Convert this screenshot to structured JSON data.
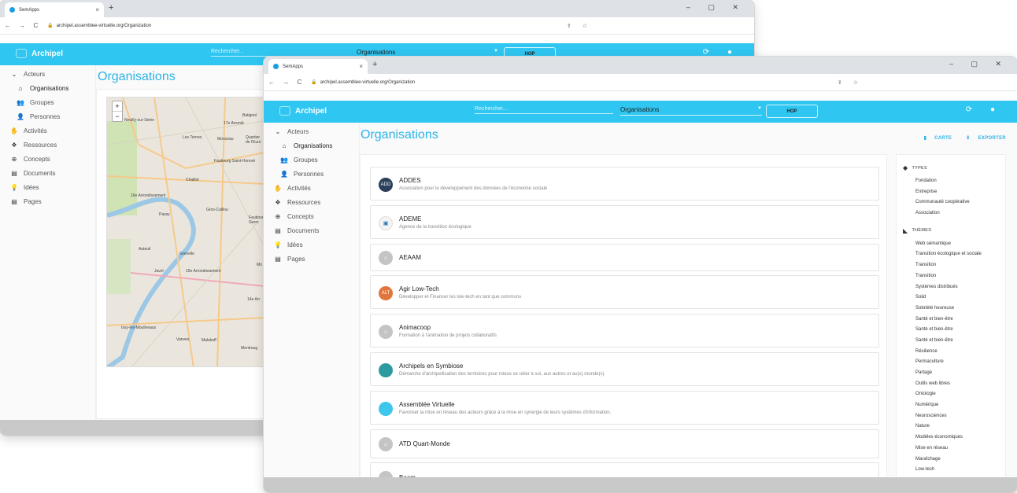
{
  "browser": {
    "tab_title": "SemApps",
    "tab_close": "×",
    "new_tab": "+",
    "window_controls": "–  ▢  ✕",
    "nav": "← → C",
    "lock": "🔒",
    "url": "archipel.assemblee-virtuelle.org/Organization",
    "tools": "⇪ ☆"
  },
  "app": {
    "brand": "Archipel",
    "search_placeholder": "Rechercher...",
    "select_value": "Organisations",
    "caret": "▼",
    "hop_label": "HOP",
    "icons": "⟳ ●"
  },
  "sidebar": {
    "items": [
      {
        "icon": "⌄",
        "label": "Acteurs"
      },
      {
        "icon": "⌂",
        "label": "Organisations"
      },
      {
        "icon": "👥",
        "label": "Groupes"
      },
      {
        "icon": "👤",
        "label": "Personnes"
      },
      {
        "icon": "✋",
        "label": "Activités"
      },
      {
        "icon": "❖",
        "label": "Ressources"
      },
      {
        "icon": "⊕",
        "label": "Concepts"
      },
      {
        "icon": "▤",
        "label": "Documents"
      },
      {
        "icon": "💡",
        "label": "Idées"
      },
      {
        "icon": "▤",
        "label": "Pages"
      }
    ]
  },
  "page": {
    "title": "Organisations",
    "action_map": "CARTE",
    "action_export": "EXPORTER"
  },
  "map": {
    "zoom_in": "+",
    "zoom_out": "−",
    "labels": [
      "Neuilly-sur-Seine",
      "Batignol",
      "17e Arrondi",
      "Les Ternes",
      "Monceau",
      "Quartier de l'Euro",
      "Faubourg Saint-Honoré",
      "Chaillot",
      "16e Arrondissement",
      "Gros-Caillou",
      "Passy",
      "Faubourg Germ",
      "Auteuil",
      "Grenelle",
      "Javel",
      "15e Arrondissement",
      "14e Arr",
      "Issy-les-Moulineaux",
      "Vanves",
      "Malakoff",
      "Montroug",
      "Mo"
    ]
  },
  "organisations": [
    {
      "name": "ADDES",
      "description": "Association pour le développement des données de l'économie sociale",
      "avatar": "ADD",
      "color": "#2a3f5a"
    },
    {
      "name": "ADEME",
      "description": "Agence de la transition écologique",
      "avatar": "▣",
      "color": "#f4f4f4"
    },
    {
      "name": "AEAAM",
      "description": "",
      "avatar": "⌂",
      "color": "#c4c4c4"
    },
    {
      "name": "Agir Low-Tech",
      "description": "Développer et Financer les low-tech en tant que communs",
      "avatar": "ALT",
      "color": "#e0763d"
    },
    {
      "name": "Animacoop",
      "description": "Formation à l'animation de projets collaboratifs",
      "avatar": "⌂",
      "color": "#c4c4c4"
    },
    {
      "name": "Archipels en Symbiose",
      "description": "Démarche d'archipellisation des territoires pour mieux se relier à soi, aux autres et au(x) monde(s)",
      "avatar": "",
      "color": "#2d9aa0"
    },
    {
      "name": "Assemblée Virtuelle",
      "description": "Favoriser la mise en réseau des acteurs grâce à la mise en synergie de leurs systèmes d'information.",
      "avatar": "",
      "color": "#3ec6ec"
    },
    {
      "name": "ATD Quart-Monde",
      "description": "",
      "avatar": "⌂",
      "color": "#c4c4c4"
    },
    {
      "name": "Baam",
      "description": "",
      "avatar": "⌂",
      "color": "#c4c4c4"
    }
  ],
  "filters": {
    "types_label": "TYPES",
    "types": [
      "Fondation",
      "Entreprise",
      "Communauté coopérative",
      "Association"
    ],
    "themes_label": "THÈMES",
    "themes": [
      "Web sémantique",
      "Transition écologique et sociale",
      "Transition",
      "Transition",
      "Systèmes distribués",
      "Solid",
      "Sobriété heureuse",
      "Santé et bien-être",
      "Santé et bien-être",
      "Santé et bien-être",
      "Résilience",
      "Permaculture",
      "Partage",
      "Outils web libres",
      "Ontologie",
      "Numérique",
      "Neurosciences",
      "Nature",
      "Modèles économiques",
      "Mise en réseau",
      "Maraîchage",
      "Low-tech"
    ]
  }
}
